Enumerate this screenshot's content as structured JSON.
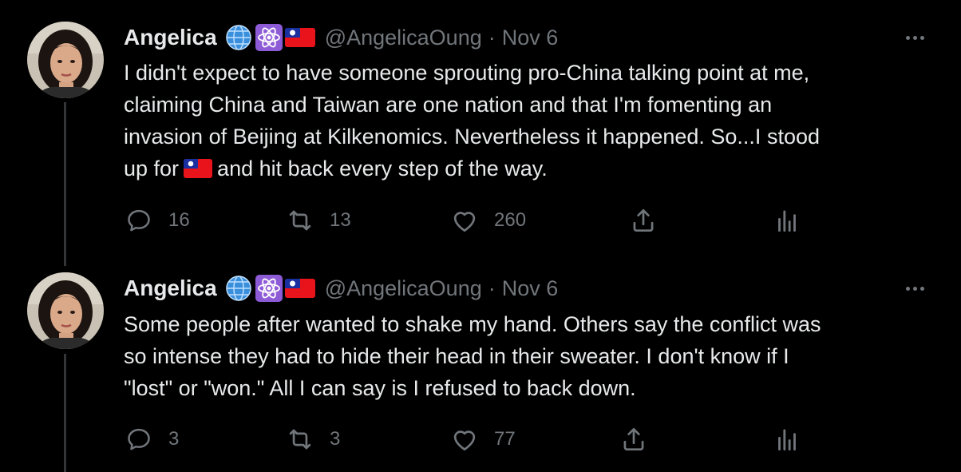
{
  "tweets": [
    {
      "name": "Angelica",
      "handle": "@AngelicaOung",
      "separator": "·",
      "date": "Nov 6",
      "badges": [
        "globe-icon",
        "atom-icon",
        "taiwan-flag-icon"
      ],
      "text": {
        "line1": "I didn't expect to have someone sprouting pro-China talking point at me,",
        "line2": "claiming China and Taiwan are one nation and that I'm fomenting an",
        "line3": "invasion of Beijing at Kilkenomics. Nevertheless it happened. So...I stood",
        "line4_before": "up for",
        "line4_after": "and hit back every step of the way."
      },
      "stats": {
        "replies": "16",
        "retweets": "13",
        "likes": "260"
      }
    },
    {
      "name": "Angelica",
      "handle": "@AngelicaOung",
      "separator": "·",
      "date": "Nov 6",
      "badges": [
        "globe-icon",
        "atom-icon",
        "taiwan-flag-icon"
      ],
      "text": {
        "line1": "Some people after wanted to shake my hand. Others say the conflict was",
        "line2": "so intense they had to hide their head in their sweater. I don't know if I",
        "line3": "\"lost\" or \"won.\" All I can say is I refused to back down."
      },
      "stats": {
        "replies": "3",
        "retweets": "3",
        "likes": "77"
      }
    }
  ],
  "colors": {
    "background": "#000000",
    "text_primary": "#e7e9ea",
    "text_secondary": "#71767b",
    "thread_line": "#333639",
    "flag_red": "#e8131b",
    "flag_blue": "#1a2fa0",
    "badge_purple": "#8e5bd6",
    "badge_globe": "#3a8fdc"
  }
}
